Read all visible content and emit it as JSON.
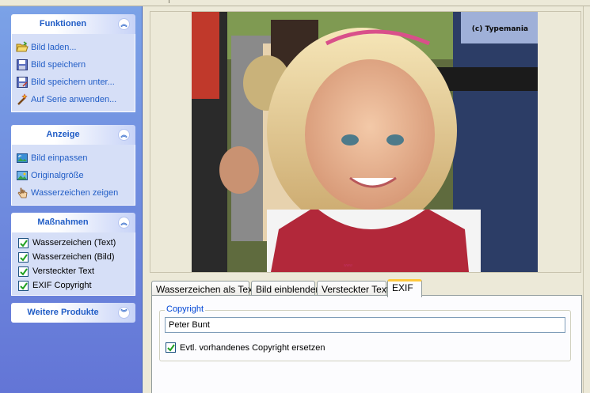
{
  "sidebar": {
    "panels": [
      {
        "title": "Funktionen",
        "collapse_glyph": "︽",
        "items": [
          {
            "label": "Bild laden...",
            "icon": "folder-open-icon"
          },
          {
            "label": "Bild speichern",
            "icon": "floppy-disk-icon"
          },
          {
            "label": "Bild speichern unter...",
            "icon": "floppy-disk-as-icon"
          },
          {
            "label": "Auf Serie anwenden...",
            "icon": "magic-wand-icon"
          }
        ]
      },
      {
        "title": "Anzeige",
        "collapse_glyph": "︽",
        "items": [
          {
            "label": "Bild einpassen",
            "icon": "fit-image-icon"
          },
          {
            "label": "Originalgröße",
            "icon": "picture-icon"
          },
          {
            "label": "Wasserzeichen zeigen",
            "icon": "hand-pointer-icon"
          }
        ]
      },
      {
        "title": "Maßnahmen",
        "collapse_glyph": "︽",
        "checks": [
          {
            "label": "Wasserzeichen (Text)",
            "checked": true
          },
          {
            "label": "Wasserzeichen (Bild)",
            "checked": true
          },
          {
            "label": "Versteckter Text",
            "checked": true
          },
          {
            "label": "EXIF Copyright",
            "checked": true
          }
        ]
      },
      {
        "title": "Weitere Produkte",
        "collapse_glyph": "︾"
      }
    ]
  },
  "photo": {
    "watermark": "(c) Typemania"
  },
  "tabs": [
    {
      "label": "Wasserzeichen als Text",
      "active": false
    },
    {
      "label": "Bild einblenden",
      "active": false
    },
    {
      "label": "Versteckter Text",
      "active": false
    },
    {
      "label": "EXIF",
      "active": true
    }
  ],
  "exif": {
    "group_label": "Copyright",
    "copyright_value": "Peter Bunt",
    "replace_label": "Evtl. vorhandenes Copyright ersetzen",
    "replace_checked": true
  },
  "colors": {
    "sidebar_top": "#7ba2e7",
    "sidebar_bottom": "#6375d6",
    "panel_title": "#215dc6",
    "tab_active_accent": "#ffc83c",
    "group_label": "#0046d5"
  }
}
